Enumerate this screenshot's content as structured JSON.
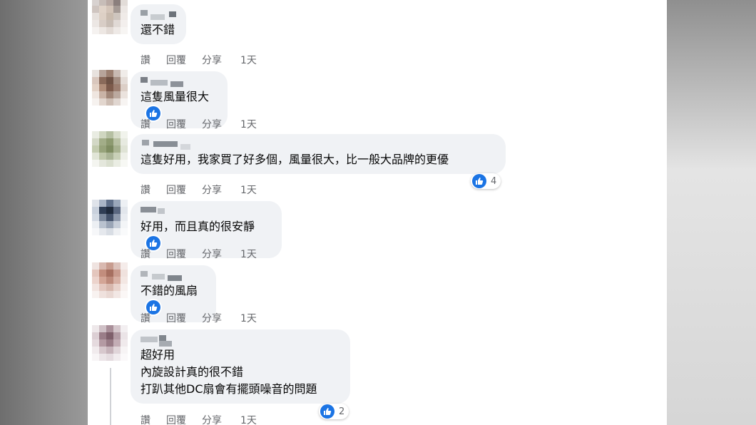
{
  "actions": {
    "like": "讚",
    "reply": "回覆",
    "share": "分享"
  },
  "comments": [
    {
      "text": "還不錯",
      "time": "1天",
      "likes": ""
    },
    {
      "text": "這隻風量很大",
      "time": "1天",
      "likes": ""
    },
    {
      "text": "這隻好用，我家買了好多個，風量很大，比一般大品牌的更優",
      "time": "1天",
      "likes": "4"
    },
    {
      "text": "好用，而且真的很安靜",
      "time": "1天",
      "likes": ""
    },
    {
      "text": "不錯的風扇",
      "time": "1天",
      "likes": ""
    },
    {
      "text": "超好用\n內旋設計真的很不錯\n打趴其他DC扇會有擺頭噪音的問題",
      "time": "1天",
      "likes": "2"
    }
  ],
  "icons": {
    "like": "thumbs-up-icon"
  },
  "colors": {
    "accent": "#1b74e4",
    "bubble": "#f0f2f5",
    "meta": "#65676b"
  }
}
